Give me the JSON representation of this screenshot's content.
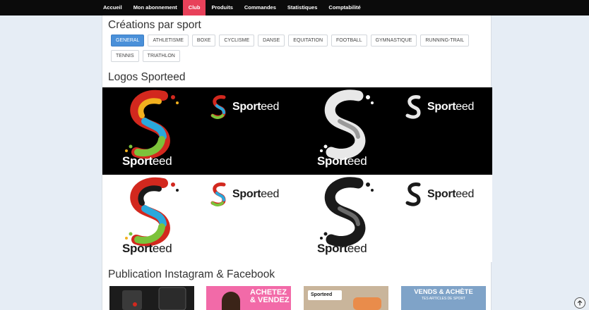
{
  "nav": {
    "items": [
      {
        "label": "Accueil"
      },
      {
        "label": "Mon abonnement"
      },
      {
        "label": "Club"
      },
      {
        "label": "Produits"
      },
      {
        "label": "Commandes"
      },
      {
        "label": "Statistiques"
      },
      {
        "label": "Comptabilité"
      }
    ],
    "active": "Club",
    "active_color": "#e8415a"
  },
  "creations": {
    "title": "Créations par sport",
    "sports": [
      "GENERAL",
      "ATHLETISME",
      "BOXE",
      "CYCLISME",
      "DANSE",
      "EQUITATION",
      "FOOTBALL",
      "GYMNASTIQUE",
      "RUNNING-TRAIL",
      "TENNIS",
      "TRIATHLON"
    ],
    "selected": "GENERAL"
  },
  "logos": {
    "title": "Logos Sporteed",
    "brand_prefix": "Sport",
    "brand_suffix": "eed"
  },
  "publication": {
    "title": "Publication Instagram & Facebook",
    "thumbs": [
      {
        "icon": "product-photo"
      },
      {
        "caption": "ACHETEZ & VENDEZ"
      },
      {
        "caption": "Sporteed"
      },
      {
        "caption": "VENDS & ACHÈTE",
        "sub": "TES ARTICLES DE SPORT"
      }
    ]
  },
  "colors": {
    "accent": "#4a90d9",
    "active_nav": "#e8415a"
  }
}
